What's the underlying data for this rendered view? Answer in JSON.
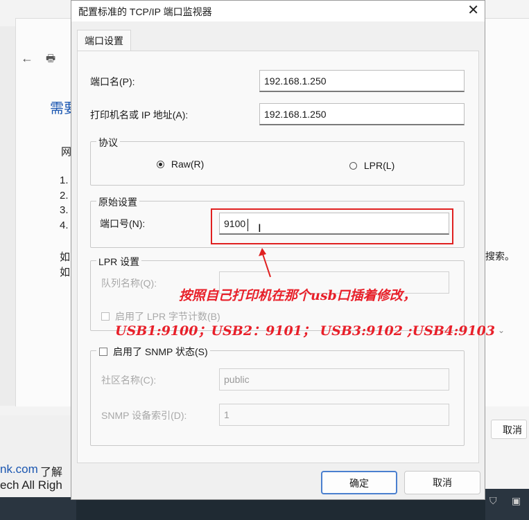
{
  "background": {
    "left_fragments": [
      "需要",
      "网",
      "1.",
      "2.",
      "3.",
      "4.",
      "如",
      "如"
    ],
    "link_fragment": "nk.com",
    "link_suffix": "了解",
    "copyright_fragment": "ech All Righ",
    "right_search_fragment": "搜索。",
    "right_cancel_label": "取消"
  },
  "dialog": {
    "title": "配置标准的 TCP/IP 端口监视器",
    "tab_label": "端口设置",
    "port_name_label": "端口名(P):",
    "port_name_value": "192.168.1.250",
    "host_label": "打印机名或 IP 地址(A):",
    "host_value": "192.168.1.250",
    "protocol": {
      "legend": "协议",
      "raw_label": "Raw(R)",
      "lpr_label": "LPR(L)",
      "selected": "Raw"
    },
    "raw_settings": {
      "legend": "原始设置",
      "port_number_label": "端口号(N):",
      "port_number_value": "9100"
    },
    "lpr_settings": {
      "legend": "LPR 设置",
      "queue_name_label": "队列名称(Q):",
      "queue_name_value": "",
      "byte_count_label": "启用了 LPR 字节计数(B)"
    },
    "snmp": {
      "checkbox_label": "启用了 SNMP 状态(S)",
      "community_label": "社区名称(C):",
      "community_value": "public",
      "device_index_label": "SNMP 设备索引(D):",
      "device_index_value": "1"
    },
    "ok_label": "确定",
    "cancel_label": "取消"
  },
  "annotation": {
    "line1": "按照自己打印机在那个usb口插着修改，",
    "line2": "USB1:9100；USB2：9101；  USB3:9102 ;USB4:9103",
    "color": "#e8202a"
  }
}
